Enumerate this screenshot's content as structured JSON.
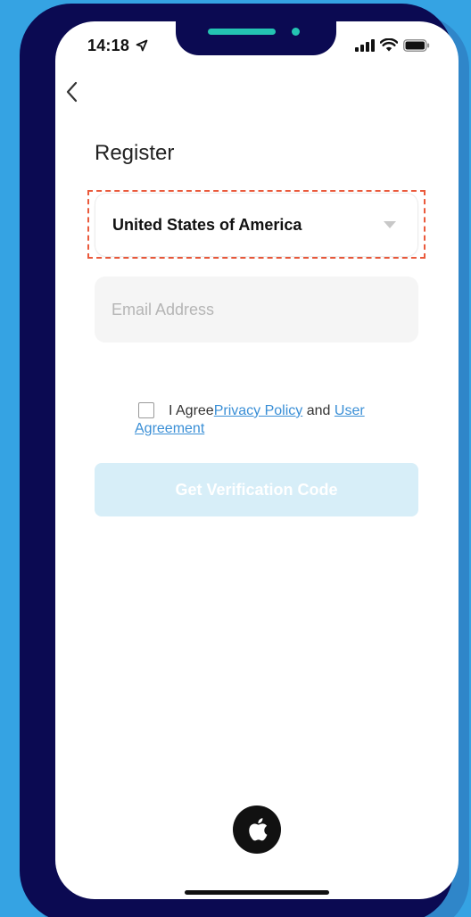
{
  "status_bar": {
    "time": "14:18",
    "icons": [
      "location-arrow-icon",
      "signal-icon",
      "wifi-icon",
      "battery-icon"
    ]
  },
  "nav": {
    "back_icon": "chevron-left-icon"
  },
  "register": {
    "title": "Register",
    "country": "United States of America",
    "email_placeholder": "Email Address",
    "agree_prefix": "I Agree",
    "privacy_policy": "Privacy Policy",
    "and": "and",
    "user_agreement_part1": "User",
    "user_agreement_part2": "Agreement",
    "verify_button": "Get Verification Code"
  },
  "social": {
    "apple_icon": "apple-icon"
  },
  "colors": {
    "phone_frame": "#0b0a52",
    "background": "#35a3e3",
    "accent_teal": "#24c4b2",
    "link": "#3a8fd6",
    "button_disabled": "#d7eef8",
    "highlight": "#ea5a3c"
  }
}
